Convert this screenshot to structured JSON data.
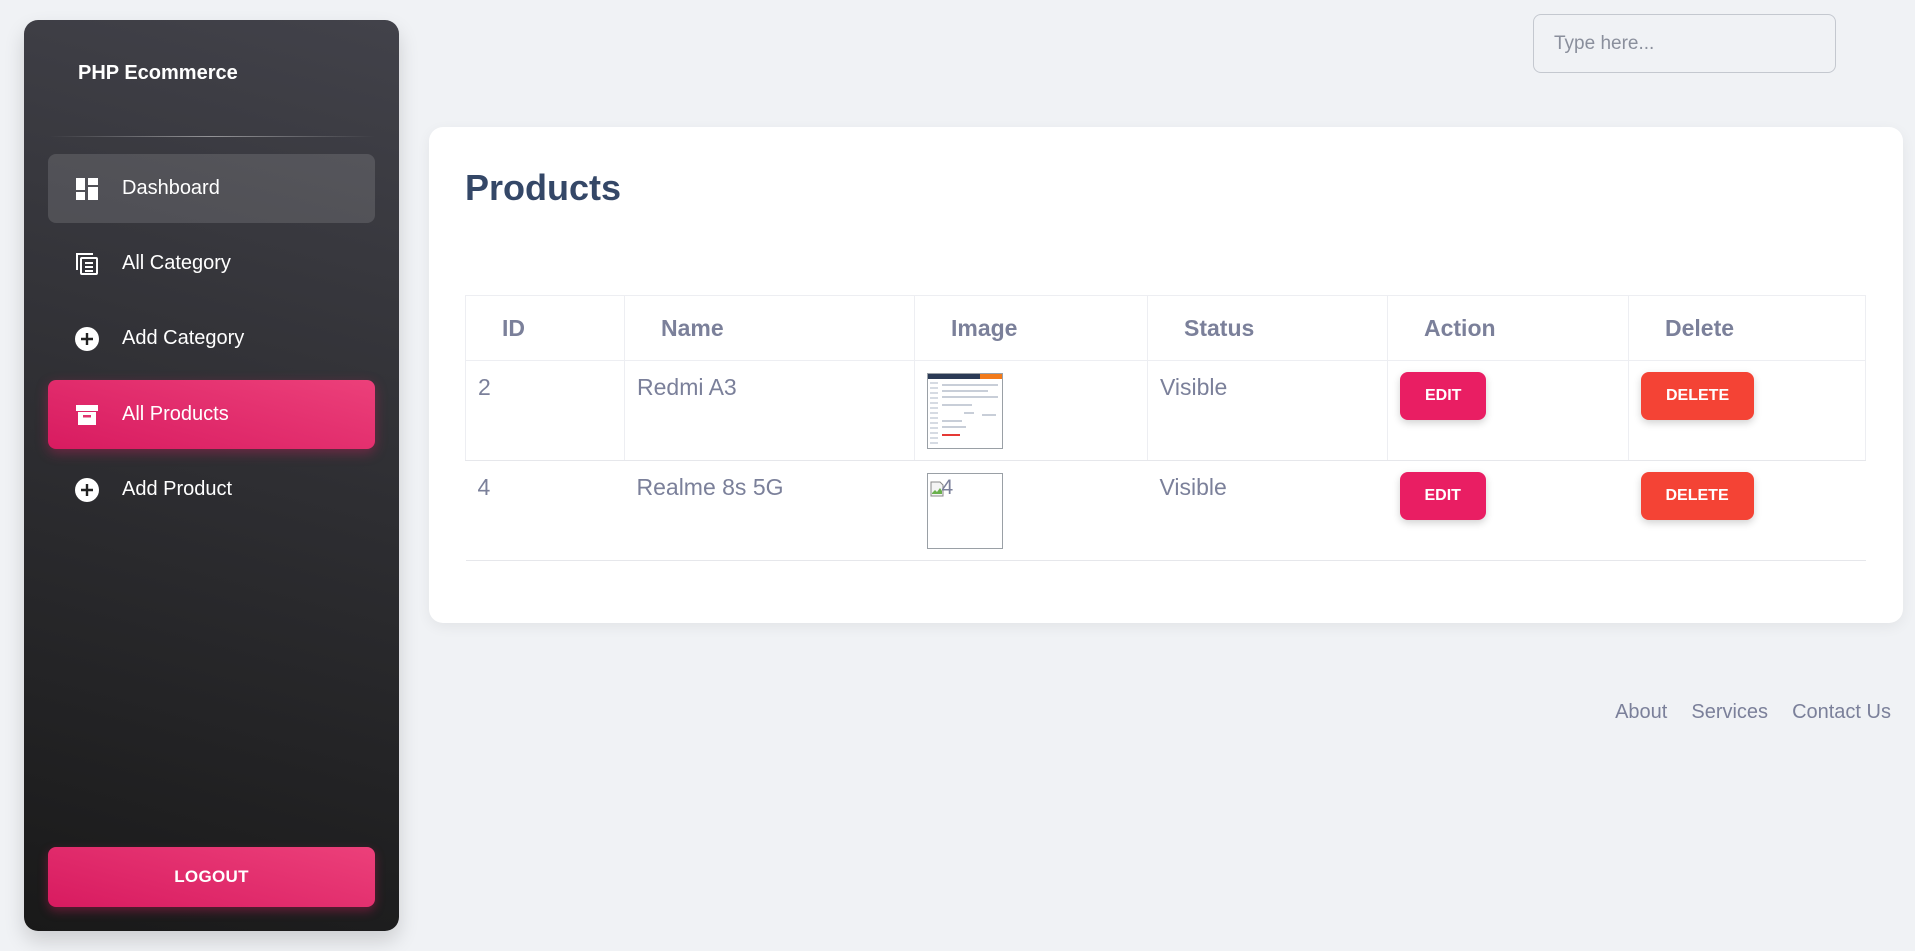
{
  "sidebar": {
    "brand": "PHP Ecommerce",
    "items": [
      {
        "label": "Dashboard",
        "icon": "dashboard-icon"
      },
      {
        "label": "All Category",
        "icon": "category-list-icon"
      },
      {
        "label": "Add Category",
        "icon": "add-circle-icon"
      },
      {
        "label": "All Products",
        "icon": "archive-box-icon"
      },
      {
        "label": "Add Product",
        "icon": "add-circle-icon"
      }
    ],
    "active_item": "All Products",
    "logout_label": "LOGOUT"
  },
  "search": {
    "placeholder": "Type here..."
  },
  "products": {
    "title": "Products",
    "columns": [
      "ID",
      "Name",
      "Image",
      "Status",
      "Action",
      "Delete"
    ],
    "rows": [
      {
        "id": "2",
        "name": "Redmi A3",
        "image": "screenshot-thumbnail",
        "status": "Visible",
        "edit": "EDIT",
        "delete": "DELETE"
      },
      {
        "id": "4",
        "name": "Realme 8s 5G",
        "image_alt": "4",
        "status": "Visible",
        "edit": "EDIT",
        "delete": "DELETE"
      }
    ]
  },
  "footer": {
    "links": [
      "About",
      "Services",
      "Contact Us"
    ]
  },
  "colors": {
    "accent": "#e91e63",
    "delete": "#f44335",
    "sidebar_dark": "#191919",
    "heading": "#344767",
    "text": "#7b809a"
  }
}
